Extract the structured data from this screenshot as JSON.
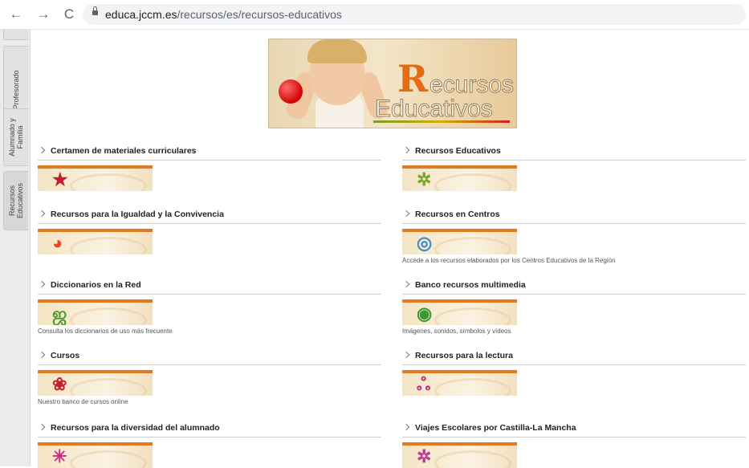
{
  "browser": {
    "back": "←",
    "forward": "→",
    "reload": "C",
    "url_host": "educa.jccm.es",
    "url_path": "/recursos/es/recursos-educativos"
  },
  "sidebar": {
    "tabs": [
      {
        "label": "Profesorado"
      },
      {
        "label": "Alumnado y Familia"
      },
      {
        "label": "Recursos Educativos"
      }
    ]
  },
  "banner": {
    "line1_initial": "R",
    "line1_rest": "ecursos",
    "line2": "Educativos"
  },
  "sections": [
    {
      "title": "Certamen de materiales curriculares",
      "desc": "",
      "icon": "star-icon",
      "glyph": "★",
      "color": "#c0202a"
    },
    {
      "title": "Recursos Educativos",
      "desc": "",
      "icon": "pinwheel-icon",
      "glyph": "✲",
      "color": "#7aa62a"
    },
    {
      "title": "Recursos para la Igualdad y la Convivencia",
      "desc": "",
      "icon": "swirl-icon",
      "glyph": "◕",
      "color": "#e04a1a"
    },
    {
      "title": "Recursos en Centros",
      "desc": "Accede a los recursos elaborados por los Centros Educativos de la Región",
      "icon": "rings-icon",
      "glyph": "◎",
      "color": "#3a8ac8"
    },
    {
      "title": "Diccionarios en la Red",
      "desc": "Consulta los diccionarios de uso más frecuente",
      "icon": "dictionary-icon",
      "glyph": "ஜ",
      "color": "#4a9a2a"
    },
    {
      "title": "Banco recursos multimedia",
      "desc": "Imágenes, sonidos, símbolos y vídeos",
      "icon": "multimedia-icon",
      "glyph": "◉",
      "color": "#3a9a30"
    },
    {
      "title": "Cursos",
      "desc": "Nuestro banco de cursos online",
      "icon": "flower-icon",
      "glyph": "❀",
      "color": "#c8202a"
    },
    {
      "title": "Recursos para la lectura",
      "desc": "",
      "icon": "reading-icon",
      "glyph": "ஃ",
      "color": "#b8307a"
    },
    {
      "title": "Recursos para la diversidad del alumnado",
      "desc": "",
      "icon": "diversity-icon",
      "glyph": "✳",
      "color": "#d02a8a"
    },
    {
      "title": "Viajes Escolares por Castilla-La Mancha",
      "desc": "",
      "icon": "travel-icon",
      "glyph": "✲",
      "color": "#c03a9a"
    }
  ]
}
